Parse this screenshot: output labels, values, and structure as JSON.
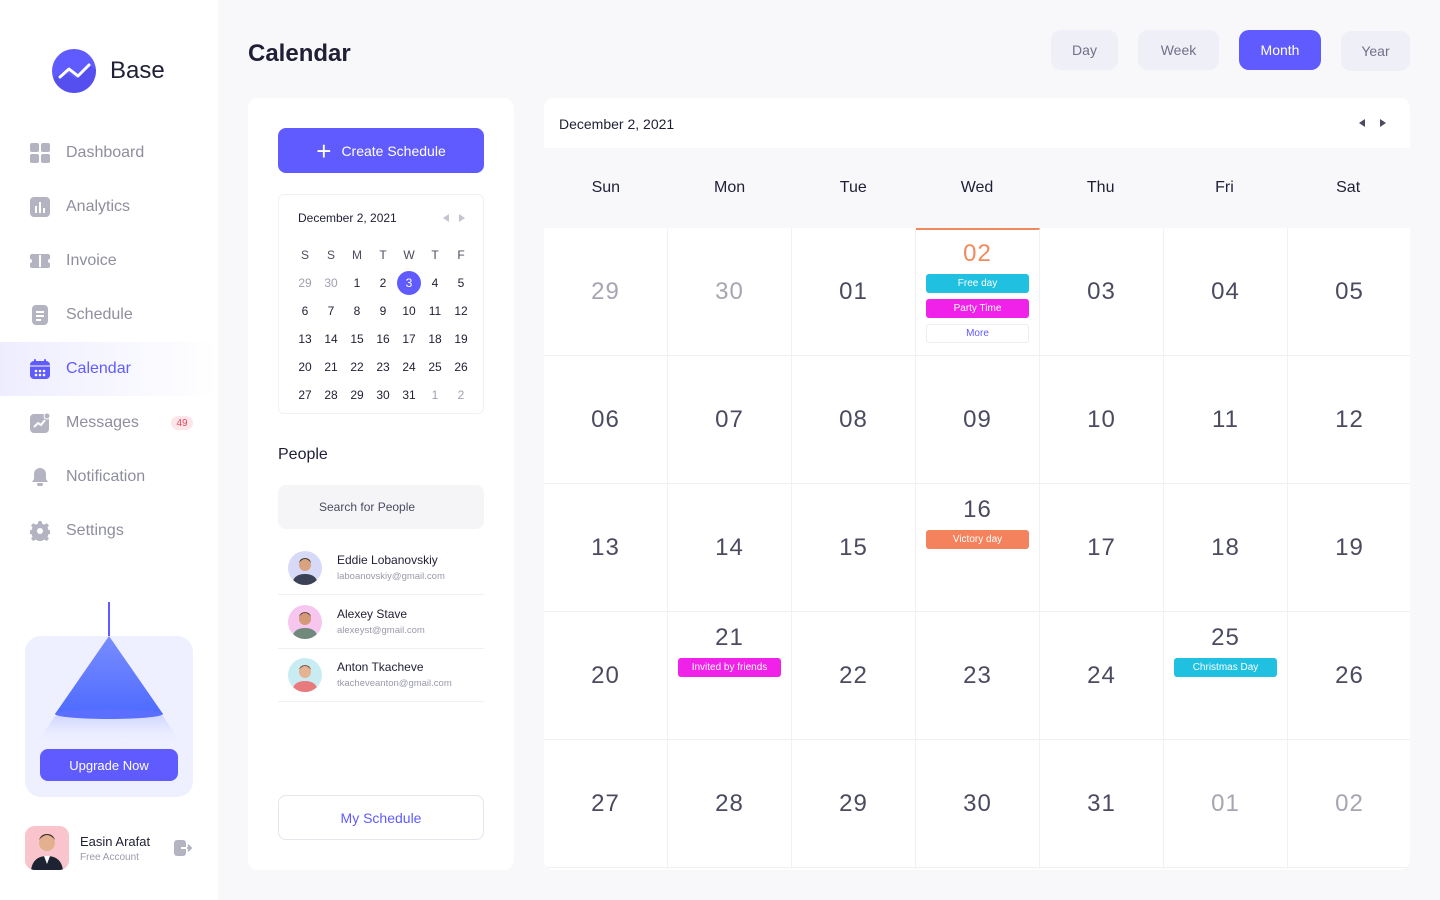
{
  "brand": {
    "name": "Base"
  },
  "nav": [
    {
      "label": "Dashboard",
      "icon": "grid-icon"
    },
    {
      "label": "Analytics",
      "icon": "chart-icon"
    },
    {
      "label": "Invoice",
      "icon": "ticket-icon"
    },
    {
      "label": "Schedule",
      "icon": "document-icon"
    },
    {
      "label": "Calendar",
      "icon": "calendar-icon",
      "active": true
    },
    {
      "label": "Messages",
      "icon": "trend-icon",
      "badge": "49"
    },
    {
      "label": "Notification",
      "icon": "bell-icon"
    },
    {
      "label": "Settings",
      "icon": "gear-icon"
    }
  ],
  "upgrade": {
    "label": "Upgrade Now"
  },
  "user": {
    "name": "Easin Arafat",
    "plan": "Free Account"
  },
  "header": {
    "title": "Calendar"
  },
  "views": [
    {
      "label": "Day"
    },
    {
      "label": "Week"
    },
    {
      "label": "Month",
      "active": true
    },
    {
      "label": "Year"
    }
  ],
  "left": {
    "create_label": "Create Schedule",
    "mini_calendar": {
      "title": "December 2, 2021",
      "dow": [
        "S",
        "S",
        "M",
        "T",
        "W",
        "T",
        "F"
      ],
      "days": [
        [
          "29",
          "30",
          "1",
          "2",
          "3",
          "4",
          "5"
        ],
        [
          "6",
          "7",
          "8",
          "9",
          "10",
          "11",
          "12"
        ],
        [
          "13",
          "14",
          "15",
          "16",
          "17",
          "18",
          "19"
        ],
        [
          "20",
          "21",
          "22",
          "23",
          "24",
          "25",
          "26"
        ],
        [
          "27",
          "28",
          "29",
          "30",
          "31",
          "1",
          "2"
        ]
      ],
      "selected": "3"
    },
    "people_title": "People",
    "search_placeholder": "Search for People",
    "people": [
      {
        "name": "Eddie Lobanovskiy",
        "email": "laboanovskiy@gmail.com"
      },
      {
        "name": "Alexey Stave",
        "email": "alexeyst@gmail.com"
      },
      {
        "name": "Anton Tkacheve",
        "email": "tkacheveanton@gmail.com"
      }
    ],
    "my_schedule_label": "My Schedule"
  },
  "calendar": {
    "date_label": "December 2, 2021",
    "weekdays": [
      "Sun",
      "Mon",
      "Tue",
      "Wed",
      "Thu",
      "Fri",
      "Sat"
    ],
    "weeks": [
      [
        {
          "d": "29",
          "muted": true
        },
        {
          "d": "30",
          "muted": true
        },
        {
          "d": "01"
        },
        {
          "d": "02",
          "today": true,
          "events": [
            {
              "label": "Free day",
              "color": "#1fc0e0"
            },
            {
              "label": "Party Time",
              "color": "#f021e8"
            },
            {
              "label": "More",
              "more": true
            }
          ]
        },
        {
          "d": "03"
        },
        {
          "d": "04"
        },
        {
          "d": "05"
        }
      ],
      [
        {
          "d": "06"
        },
        {
          "d": "07"
        },
        {
          "d": "08"
        },
        {
          "d": "09"
        },
        {
          "d": "10"
        },
        {
          "d": "11"
        },
        {
          "d": "12"
        }
      ],
      [
        {
          "d": "13"
        },
        {
          "d": "14"
        },
        {
          "d": "15"
        },
        {
          "d": "16",
          "events": [
            {
              "label": "Victory day",
              "color": "#f4825d"
            }
          ]
        },
        {
          "d": "17"
        },
        {
          "d": "18"
        },
        {
          "d": "19"
        }
      ],
      [
        {
          "d": "20"
        },
        {
          "d": "21",
          "events": [
            {
              "label": "Invited by friends",
              "color": "#f021e8"
            }
          ]
        },
        {
          "d": "22"
        },
        {
          "d": "23"
        },
        {
          "d": "24"
        },
        {
          "d": "25",
          "events": [
            {
              "label": "Christmas Day",
              "color": "#1fc0e0"
            }
          ]
        },
        {
          "d": "26"
        }
      ],
      [
        {
          "d": "27"
        },
        {
          "d": "28"
        },
        {
          "d": "29"
        },
        {
          "d": "30"
        },
        {
          "d": "31"
        },
        {
          "d": "01",
          "muted": true
        },
        {
          "d": "02",
          "muted": true
        }
      ]
    ]
  },
  "colors": {
    "accent": "#605bff",
    "today": "#f08a5d"
  }
}
